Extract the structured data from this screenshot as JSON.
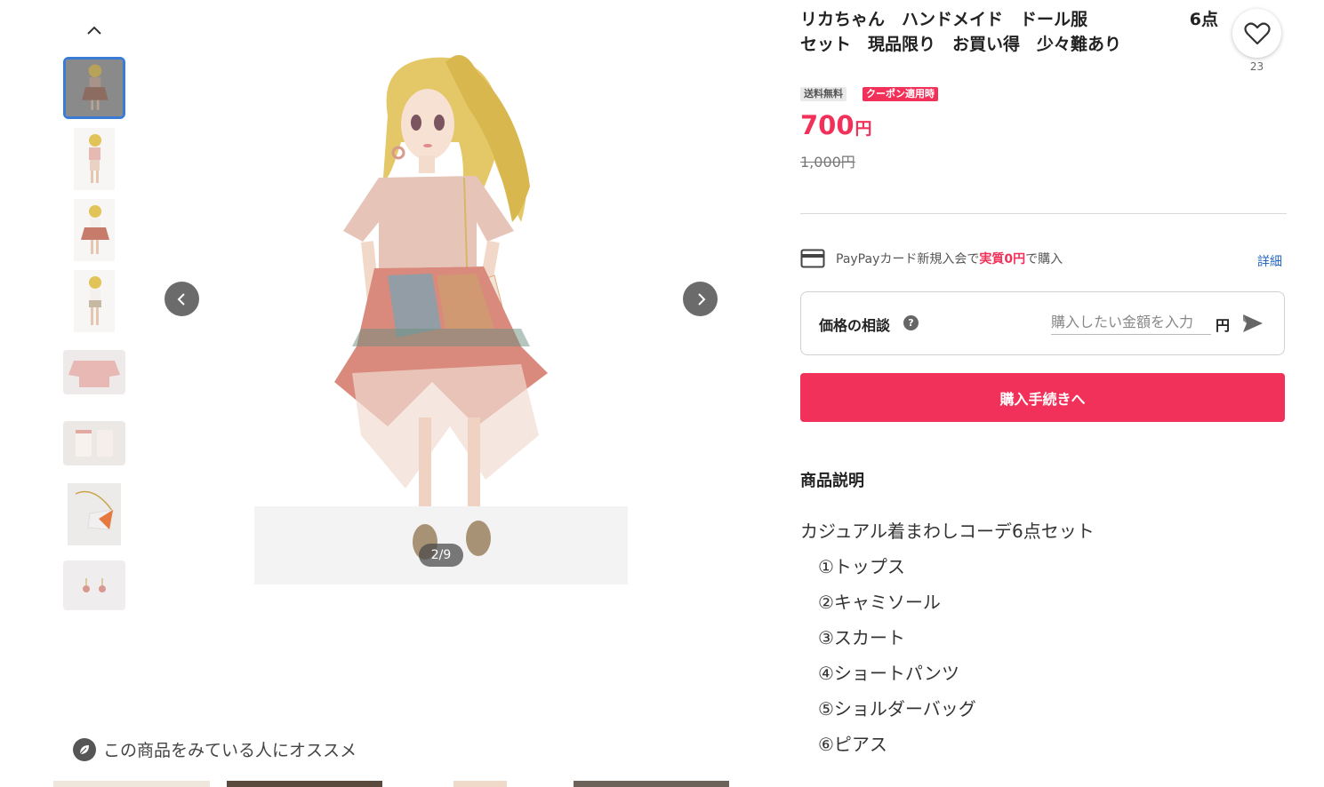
{
  "gallery": {
    "counter": "2/9",
    "thumbnails": [
      {
        "name": "thumb-1",
        "active": true
      },
      {
        "name": "thumb-2",
        "active": false
      },
      {
        "name": "thumb-3",
        "active": false
      },
      {
        "name": "thumb-4",
        "active": false
      },
      {
        "name": "thumb-5",
        "active": false
      },
      {
        "name": "thumb-6",
        "active": false
      },
      {
        "name": "thumb-7",
        "active": false
      },
      {
        "name": "thumb-8",
        "active": false
      }
    ],
    "icons": {
      "up": "chevron-up-icon",
      "prev": "chevron-left-icon",
      "next": "chevron-right-icon"
    }
  },
  "product": {
    "title_line1_a": "リカちゃん　ハンドメイド　ドール服",
    "title_line1_b": "6点",
    "title_line2": "セット　現品限り　お買い得　少々難あり",
    "like_count": "23",
    "badge_shipping": "送料無料",
    "badge_coupon": "クーポン適用時",
    "price": "700",
    "price_unit": "円",
    "original_price": "1,000円"
  },
  "paypay": {
    "text_before": "PayPayカード新規入会で",
    "highlight": "実質0円",
    "text_after": "で購入",
    "detail_link": "詳細"
  },
  "negotiation": {
    "label": "価格の相談",
    "help": "?",
    "placeholder": "購入したい金額を入力",
    "unit": "円"
  },
  "buy_button": "購入手続きへ",
  "description": {
    "heading": "商品説明",
    "intro": "カジュアル着まわしコーデ6点セット",
    "items": [
      "①トップス",
      "②キャミソール",
      "③スカート",
      "④ショートパンツ",
      "⑤ショルダーバッグ",
      "⑥ピアス"
    ]
  },
  "recommend": {
    "title": "この商品をみている人にオススメ"
  },
  "colors": {
    "accent": "#f2315a",
    "link": "#2468c3",
    "thumb_active_border": "#3a7bd5"
  }
}
